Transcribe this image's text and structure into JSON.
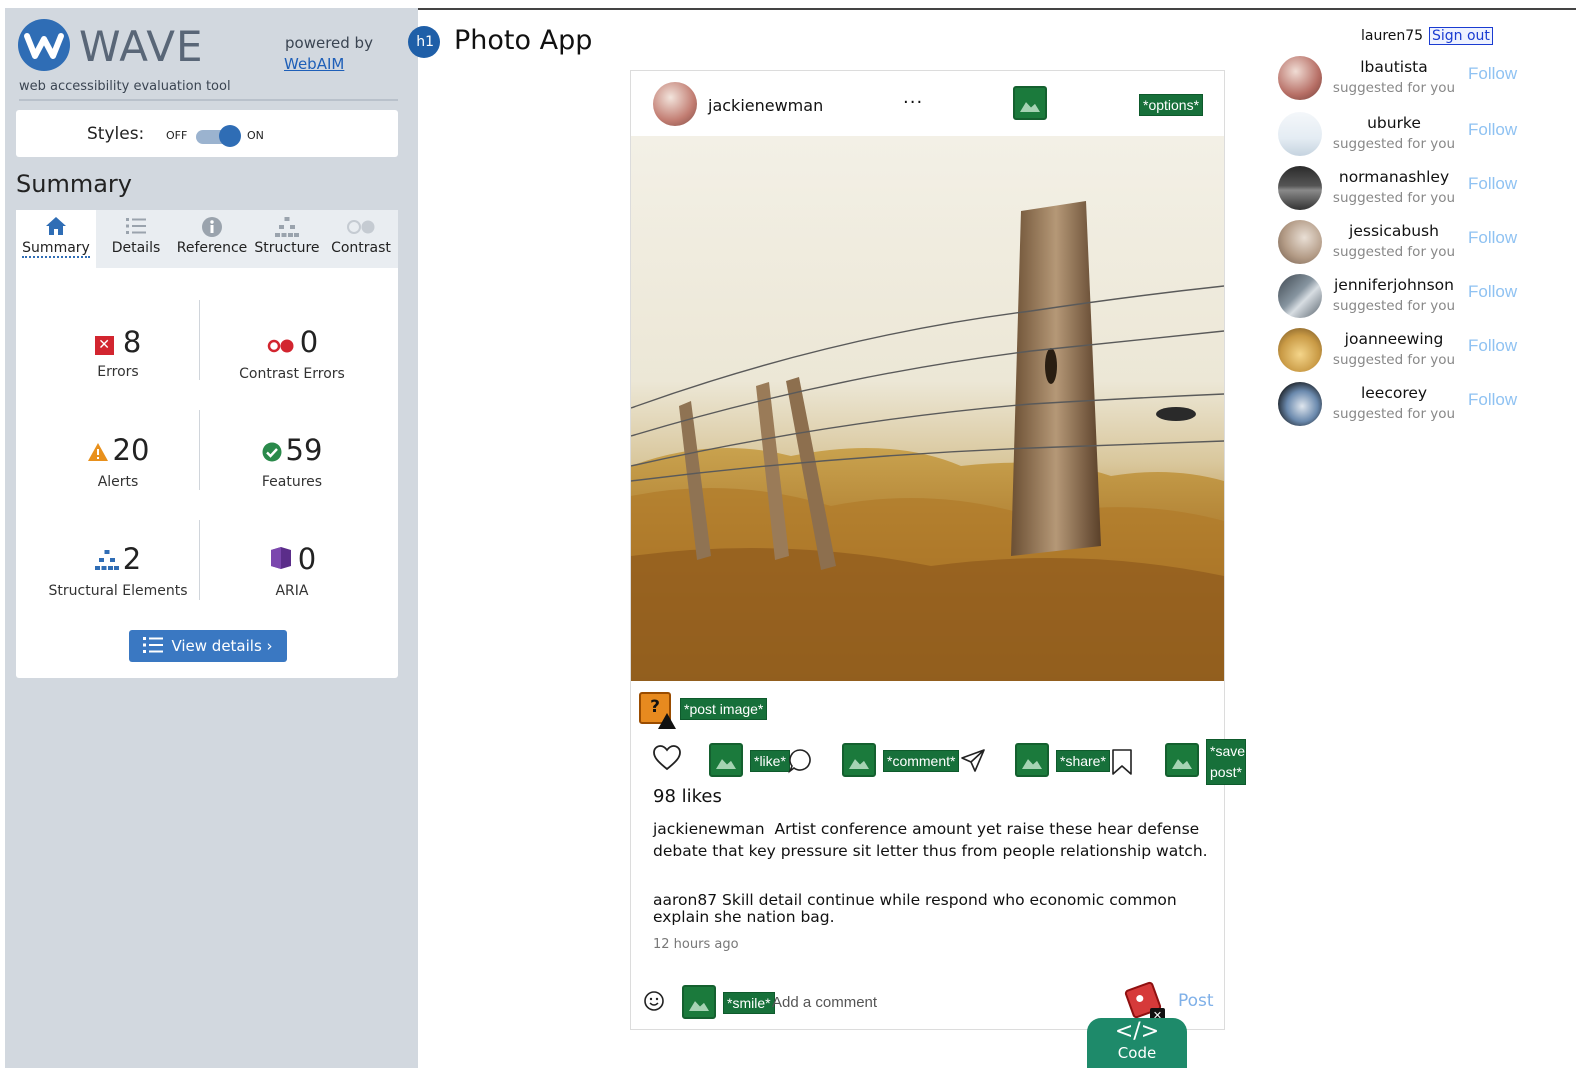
{
  "wave": {
    "title": "WAVE",
    "subtitle": "web accessibility evaluation tool",
    "powered_by": "powered by",
    "webaim_link": "WebAIM",
    "styles_label": "Styles:",
    "styles_off": "OFF",
    "styles_on": "ON",
    "summary_heading": "Summary",
    "tabs": [
      {
        "label": "Summary",
        "icon": "home-icon",
        "active": true
      },
      {
        "label": "Details",
        "icon": "list-icon",
        "active": false
      },
      {
        "label": "Reference",
        "icon": "info-icon",
        "active": false
      },
      {
        "label": "Structure",
        "icon": "hierarchy-icon",
        "active": false
      },
      {
        "label": "Contrast",
        "icon": "contrast-icon",
        "active": false
      }
    ],
    "stats": {
      "errors": {
        "count": "8",
        "label": "Errors",
        "color": "#d2252f"
      },
      "contrast_errors": {
        "count": "0",
        "label": "Contrast Errors",
        "color": "#d2252f"
      },
      "alerts": {
        "count": "20",
        "label": "Alerts",
        "color": "#e8901c"
      },
      "features": {
        "count": "59",
        "label": "Features",
        "color": "#2a8a4b"
      },
      "structural": {
        "count": "2",
        "label": "Structural Elements",
        "color": "#2f6db5"
      },
      "aria": {
        "count": "0",
        "label": "ARIA",
        "color": "#5b2d8a"
      }
    },
    "view_details": "View details ›"
  },
  "app": {
    "h1_badge": "h1",
    "title": "Photo App",
    "user": "lauren75",
    "sign_out": "Sign out"
  },
  "post": {
    "username": "jackienewman",
    "more": "···",
    "options_tag": "*options*",
    "post_image_tag": "*post image*",
    "like_tag": "*like*",
    "comment_tag": "*comment*",
    "share_tag": "*share*",
    "save_tag_line1": "*save",
    "save_tag_line2": "post*",
    "likes": "98 likes",
    "caption_user": "jackienewman",
    "caption_text": "Artist conference amount yet raise these hear defense debate that key pressure sit letter thus from people relationship watch.",
    "comment_user": "aaron87",
    "comment_text": "Skill detail continue while respond who economic common explain she nation bag.",
    "time": "12 hours ago",
    "smile_tag": "*smile*",
    "add_comment_placeholder": "Add a comment",
    "post_button": "Post"
  },
  "code_tab": {
    "glyph": "</>",
    "label": "Code"
  },
  "suggestions": [
    {
      "name": "lbautista",
      "sub": "suggested for you",
      "follow": "Follow"
    },
    {
      "name": "uburke",
      "sub": "suggested for you",
      "follow": "Follow"
    },
    {
      "name": "normanashley",
      "sub": "suggested for you",
      "follow": "Follow"
    },
    {
      "name": "jessicabush",
      "sub": "suggested for you",
      "follow": "Follow"
    },
    {
      "name": "jenniferjohnson",
      "sub": "suggested for you",
      "follow": "Follow"
    },
    {
      "name": "joanneewing",
      "sub": "suggested for you",
      "follow": "Follow"
    },
    {
      "name": "leecorey",
      "sub": "suggested for you",
      "follow": "Follow"
    }
  ]
}
